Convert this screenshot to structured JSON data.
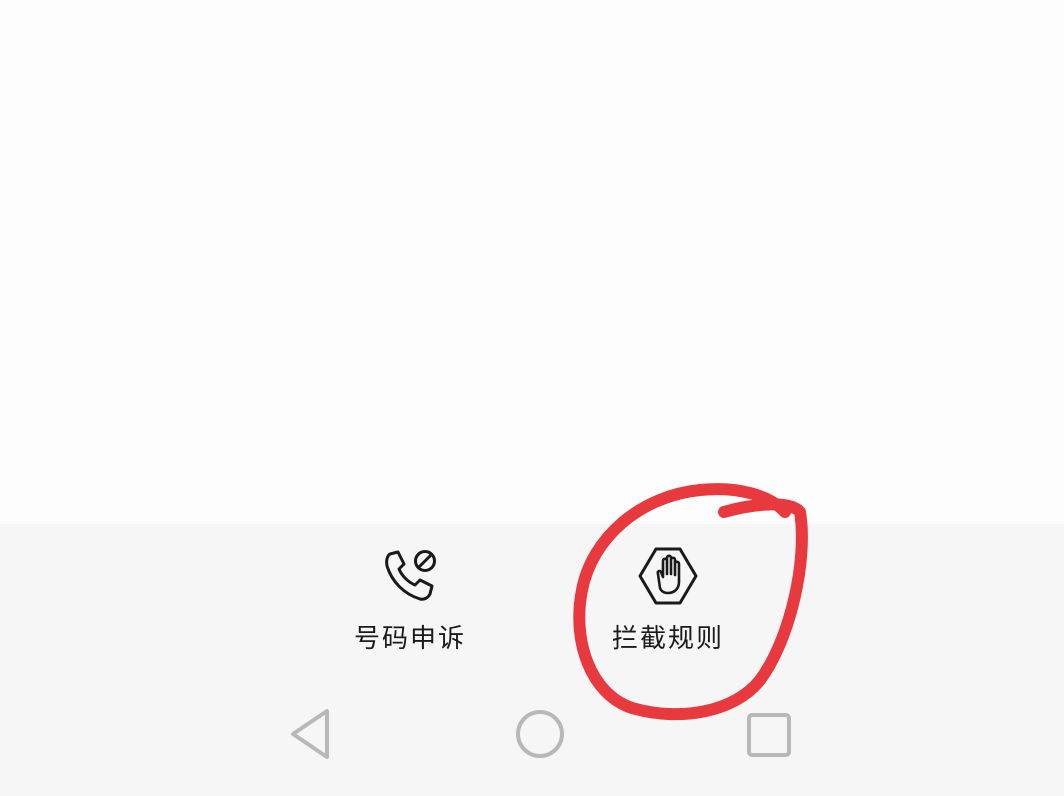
{
  "actions": [
    {
      "id": "appeal",
      "label": "号码申诉",
      "icon": "phone-blocked-icon"
    },
    {
      "id": "rules",
      "label": "拦截规则",
      "icon": "stop-hand-icon"
    }
  ],
  "nav": {
    "back_icon": "back-triangle-icon",
    "home_icon": "home-circle-icon",
    "recent_icon": "recent-square-icon"
  },
  "colors": {
    "panel_bg": "#f6f6f6",
    "content_bg": "#fdfdfd",
    "icon_dark": "#1a1a1a",
    "nav_gray": "#b8b8b8",
    "annotation_red": "#e8393f"
  }
}
